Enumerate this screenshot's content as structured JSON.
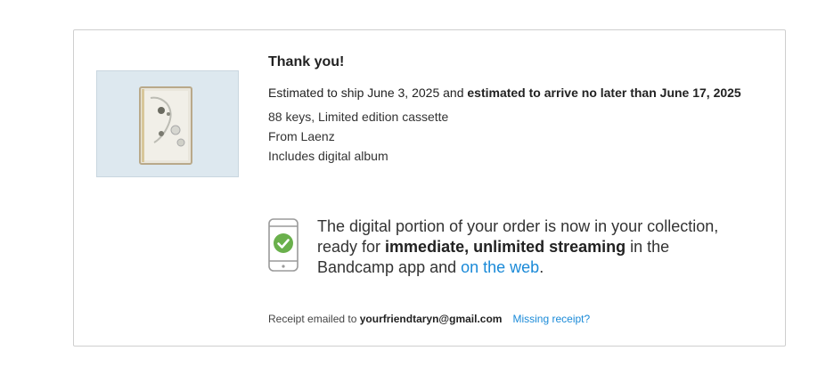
{
  "order": {
    "title": "Thank you!",
    "ship_prefix": "Estimated to ship June 3, 2025 and ",
    "ship_bold": "estimated to arrive no later than June 17, 2025",
    "item_line": "88 keys, Limited edition cassette",
    "from_line": "From Laenz",
    "includes_line": "Includes digital album"
  },
  "digital": {
    "text_1": "The digital portion of your order is now in your collection, ready for ",
    "text_bold": "immediate, unlimited streaming",
    "text_2": " in the Bandcamp app and ",
    "link_label": "on the web",
    "text_end": ".",
    "icon": "phone-check-icon",
    "check_color": "#6ab04c"
  },
  "receipt": {
    "prefix": "Receipt emailed to ",
    "email": "yourfriendtaryn@gmail.com",
    "missing_label": "Missing receipt?"
  },
  "colors": {
    "link": "#1a8ad8",
    "border": "#cfcfcf"
  }
}
